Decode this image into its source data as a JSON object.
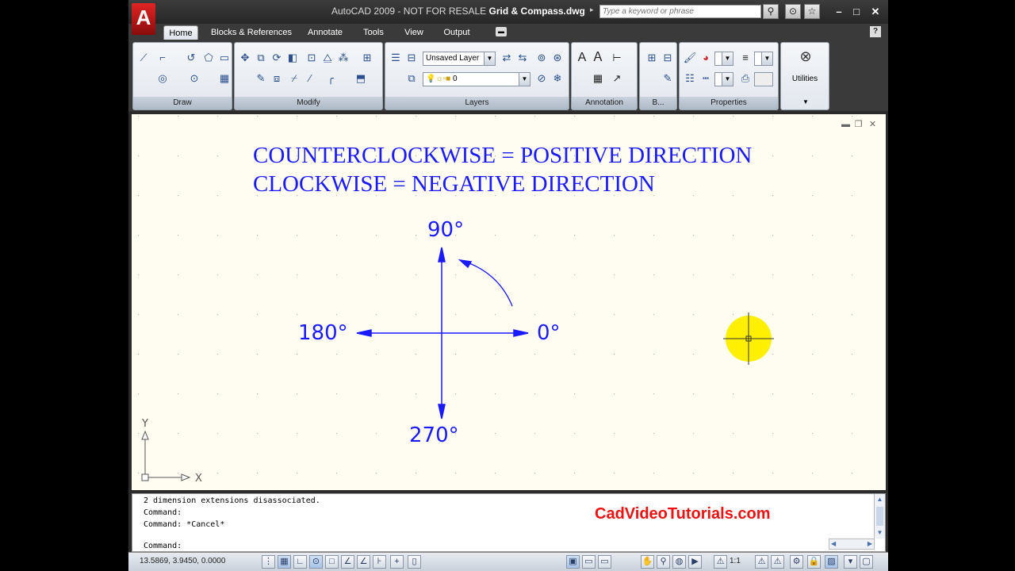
{
  "app": {
    "logo": "A",
    "title_prefix": "AutoCAD 2009 - NOT FOR RESALE",
    "file_name": "Grid & Compass.dwg",
    "search_placeholder": "Type a keyword or phrase"
  },
  "tabs": [
    {
      "label": "Home",
      "active": true
    },
    {
      "label": "Blocks & References"
    },
    {
      "label": "Annotate"
    },
    {
      "label": "Tools"
    },
    {
      "label": "View"
    },
    {
      "label": "Output"
    }
  ],
  "panels": {
    "draw": "Draw",
    "modify": "Modify",
    "layers": "Layers",
    "annotation": "Annotation",
    "blocks": "B...",
    "properties": "Properties",
    "utilities": "Utilities",
    "layer_combo": "Unsaved Layer",
    "layer_state": "0"
  },
  "drawing": {
    "line1": "COUNTERCLOCKWISE = POSITIVE DIRECTION",
    "line2": "CLOCKWISE = NEGATIVE DIRECTION",
    "angle_90": "90°",
    "angle_0": "0°",
    "angle_180": "180°",
    "angle_270": "270°",
    "ucs_x": "X",
    "ucs_y": "Y",
    "text_color": "#1a1aff",
    "cursor_highlight": "#ffef00"
  },
  "command": {
    "lines": [
      "2 dimension extensions disassociated.",
      "Command:",
      "Command: *Cancel*"
    ],
    "prompt": "Command:"
  },
  "watermark": "CadVideoTutorials.com",
  "status": {
    "coords": "13.5869, 3.9450, 0.0000",
    "annotation_scale": "1:1"
  }
}
